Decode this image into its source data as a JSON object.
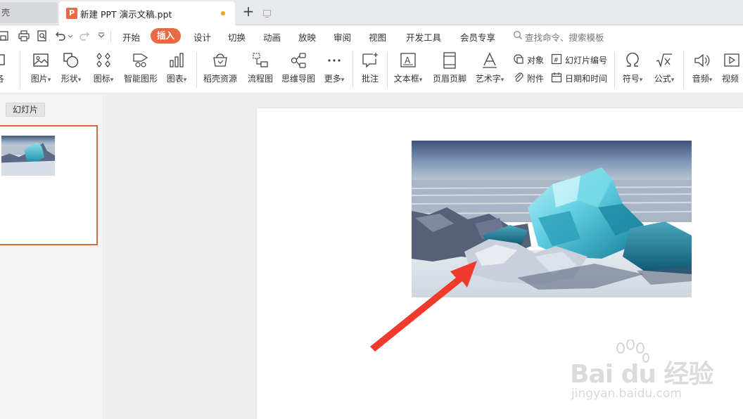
{
  "tabs": {
    "prev_tab_label": "壳",
    "active_tab_logo": "P",
    "active_tab_title": "新建 PPT 演示文稿.ppt",
    "add_tab_symbol": "+"
  },
  "menu": {
    "items": [
      "开始",
      "插入",
      "设计",
      "切换",
      "动画",
      "放映",
      "审阅",
      "视图",
      "开发工具",
      "会员专享"
    ],
    "active": "插入",
    "search_placeholder": "查找命令、搜索模板"
  },
  "ribbon": {
    "partial_left_label": "各",
    "picture": "图片",
    "shape": "形状",
    "icon": "图标",
    "smart_graphic": "智能图形",
    "chart": "图表",
    "docer_resources": "稻壳资源",
    "flowchart": "流程图",
    "mindmap": "思维导图",
    "more": "更多",
    "comment": "批注",
    "textbox": "文本框",
    "header_footer": "页眉页脚",
    "wordart": "艺术字",
    "object": "对象",
    "attachment": "附件",
    "slide_number": "幻灯片编号",
    "date_time": "日期和时间",
    "symbol": "符号",
    "formula": "公式",
    "audio": "音频",
    "video": "视频",
    "dropdown_glyph": "▾"
  },
  "left_panel": {
    "slides_tab_label": "幻灯片"
  },
  "watermark": {
    "main": "Bai du 经验",
    "url": "jingyan.baidu.com"
  },
  "colors": {
    "accent": "#e96b46",
    "arrow": "#f03a2c",
    "thumb_border": "#d86a37"
  },
  "icons": [
    "picture-icon",
    "shape-icon",
    "icon-icon",
    "smart-graphic-icon",
    "chart-icon",
    "docer-icon",
    "flowchart-icon",
    "mindmap-icon",
    "more-icon",
    "comment-icon",
    "textbox-icon",
    "header-footer-icon",
    "wordart-icon",
    "object-icon",
    "attachment-icon",
    "slide-number-icon",
    "date-time-icon",
    "symbol-icon",
    "formula-icon",
    "audio-icon",
    "video-icon"
  ]
}
